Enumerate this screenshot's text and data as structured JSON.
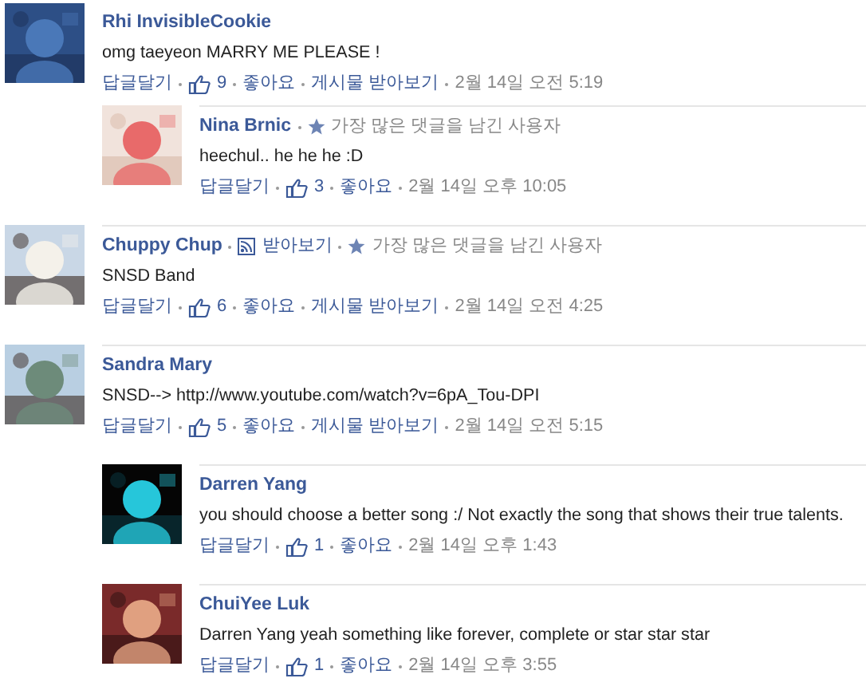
{
  "comments": [
    {
      "kind": "comment",
      "author": "Rhi InvisibleCookie",
      "text": "omg taeyeon MARRY ME PLEASE !",
      "reply": "답글달기",
      "likes": "9",
      "like": "좋아요",
      "follow": "게시물 받아보기",
      "time": "2월 14일 오전 5:19"
    },
    {
      "kind": "reply",
      "author": "Nina Brnic",
      "badge": "가장 많은 댓글을 남긴 사용자",
      "text": "heechul.. he he he :D",
      "reply": "답글달기",
      "likes": "3",
      "like": "좋아요",
      "time": "2월 14일 오후 10:05"
    },
    {
      "kind": "comment",
      "author": "Chuppy Chup",
      "subscribe": "받아보기",
      "badge": "가장 많은 댓글을 남긴 사용자",
      "text": "SNSD Band",
      "reply": "답글달기",
      "likes": "6",
      "like": "좋아요",
      "follow": "게시물 받아보기",
      "time": "2월 14일 오전 4:25"
    },
    {
      "kind": "comment",
      "author": "Sandra Mary",
      "text": "SNSD--> http://www.youtube.com/watch?v=6pA_Tou-DPI",
      "reply": "답글달기",
      "likes": "5",
      "like": "좋아요",
      "follow": "게시물 받아보기",
      "time": "2월 14일 오전 5:15"
    },
    {
      "kind": "reply",
      "author": "Darren Yang",
      "text": "you should choose a better song :/ Not exactly the song that shows their true talents.",
      "reply": "답글달기",
      "likes": "1",
      "like": "좋아요",
      "time": "2월 14일 오후 1:43"
    },
    {
      "kind": "reply",
      "author": "ChuiYee Luk",
      "text": "Darren Yang yeah something like forever, complete or star star star",
      "reply": "답글달기",
      "likes": "1",
      "like": "좋아요",
      "time": "2월 14일 오후 3:55"
    }
  ]
}
